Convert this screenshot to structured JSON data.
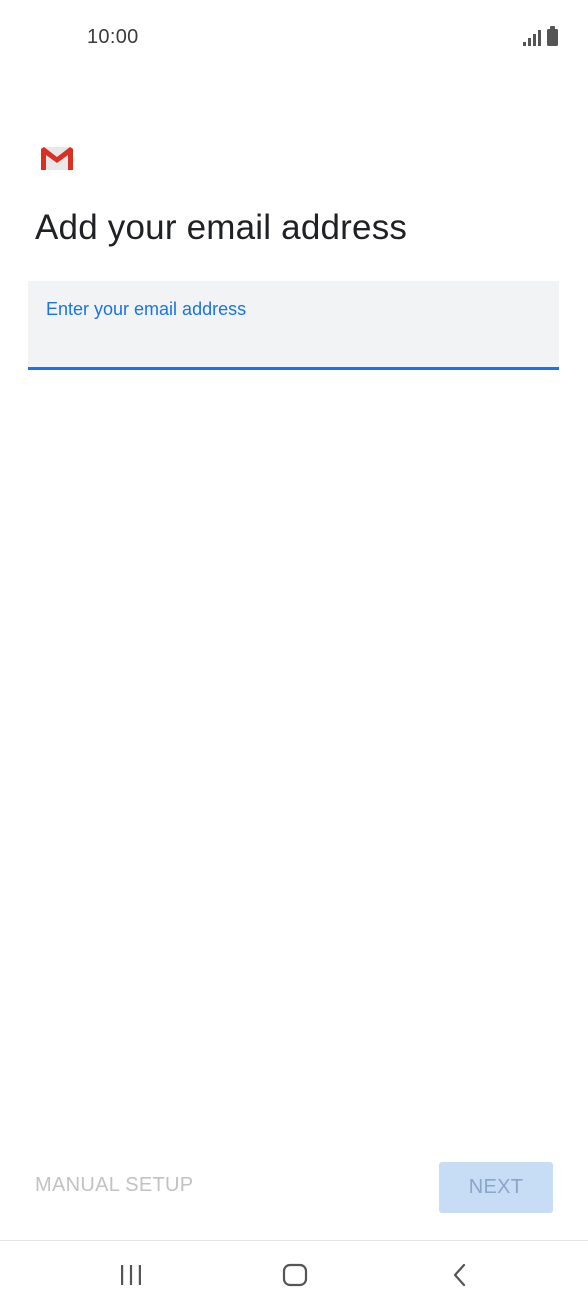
{
  "status_bar": {
    "time": "10:00",
    "icons": [
      "signal-icon",
      "battery-icon"
    ]
  },
  "app": {
    "logo_icon": "gmail-logo-icon",
    "title": "Add your email address"
  },
  "email_field": {
    "label": "Enter your email address",
    "value": ""
  },
  "actions": {
    "manual_setup_label": "MANUAL SETUP",
    "next_label": "NEXT"
  },
  "nav_bar": {
    "icons": [
      "recents-icon",
      "home-icon",
      "back-icon"
    ]
  },
  "colors": {
    "accent": "#1a73e8",
    "field_background": "#f1f3f4",
    "disabled_button": "#c7dcf5",
    "gmail_red": "#d93025"
  }
}
